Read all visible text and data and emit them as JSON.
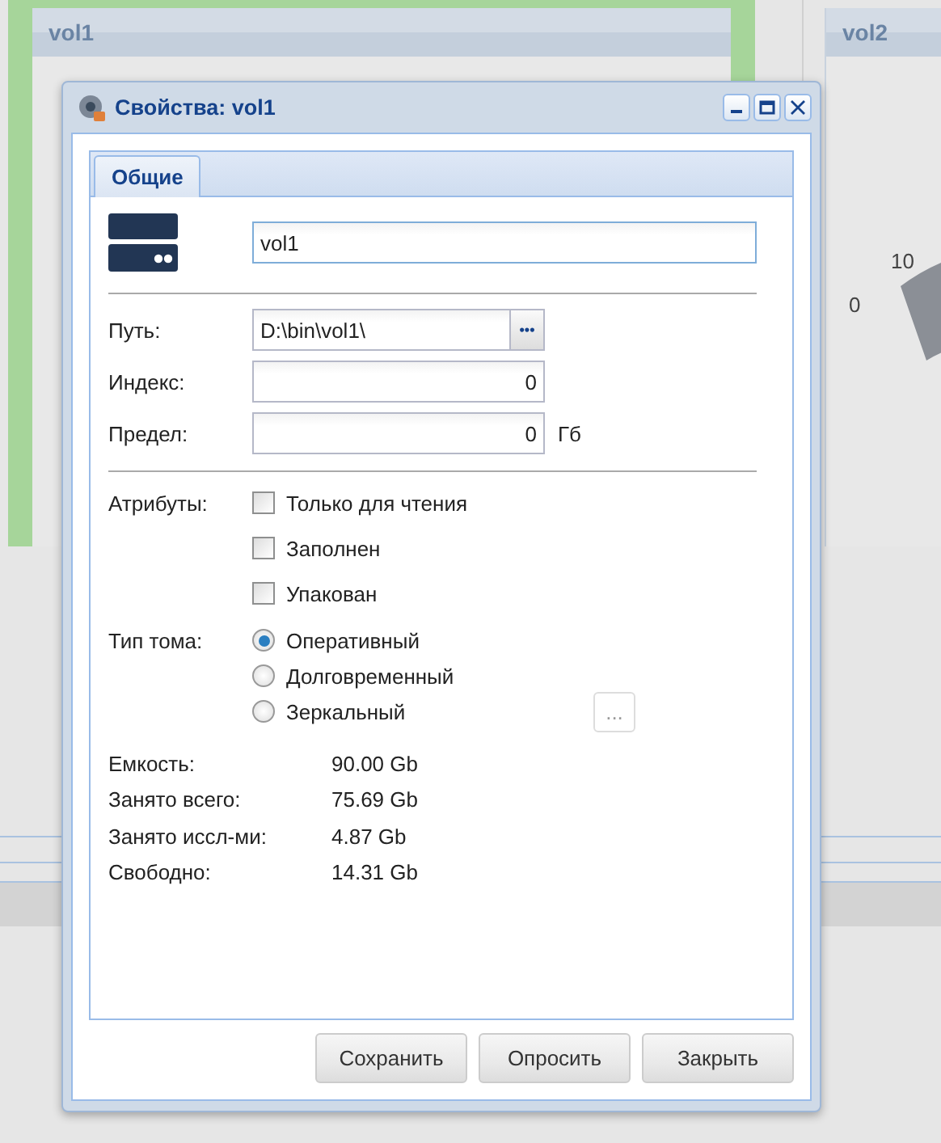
{
  "background": {
    "panels": [
      {
        "title": "vol1",
        "selected": true
      },
      {
        "title": "vol2",
        "selected": false,
        "gauge_ticks": [
          "0",
          "10"
        ]
      }
    ]
  },
  "dialog": {
    "title": "Свойства: vol1",
    "tabs": [
      {
        "label": "Общие",
        "selected": true
      }
    ],
    "name": {
      "value": "vol1"
    },
    "fields": [
      {
        "label": "Путь:",
        "value": "D:\\bin\\vol1\\",
        "kind": "text",
        "browse_button": "•••"
      },
      {
        "label": "Индекс:",
        "value": "0",
        "kind": "number"
      },
      {
        "label": "Предел:",
        "value": "0",
        "kind": "number",
        "unit": "Гб"
      }
    ],
    "attributes": {
      "label": "Атрибуты:",
      "options": [
        {
          "label": "Только для чтения",
          "checked": false
        },
        {
          "label": "Заполнен",
          "checked": false
        },
        {
          "label": "Упакован",
          "checked": false
        }
      ]
    },
    "volume_type": {
      "label": "Тип тома:",
      "options": [
        {
          "label": "Оперативный",
          "selected": true
        },
        {
          "label": "Долговременный",
          "selected": false
        },
        {
          "label": "Зеркальный",
          "selected": false
        }
      ],
      "more_button": "..."
    },
    "stats": [
      {
        "label": "Емкость:",
        "value": "90.00 Gb"
      },
      {
        "label": "Занято всего:",
        "value": "75.69 Gb"
      },
      {
        "label": "Занято иссл-ми:",
        "value": "4.87 Gb"
      },
      {
        "label": "Свободно:",
        "value": "14.31 Gb"
      }
    ],
    "buttons": [
      "Сохранить",
      "Опросить",
      "Закрыть"
    ]
  }
}
